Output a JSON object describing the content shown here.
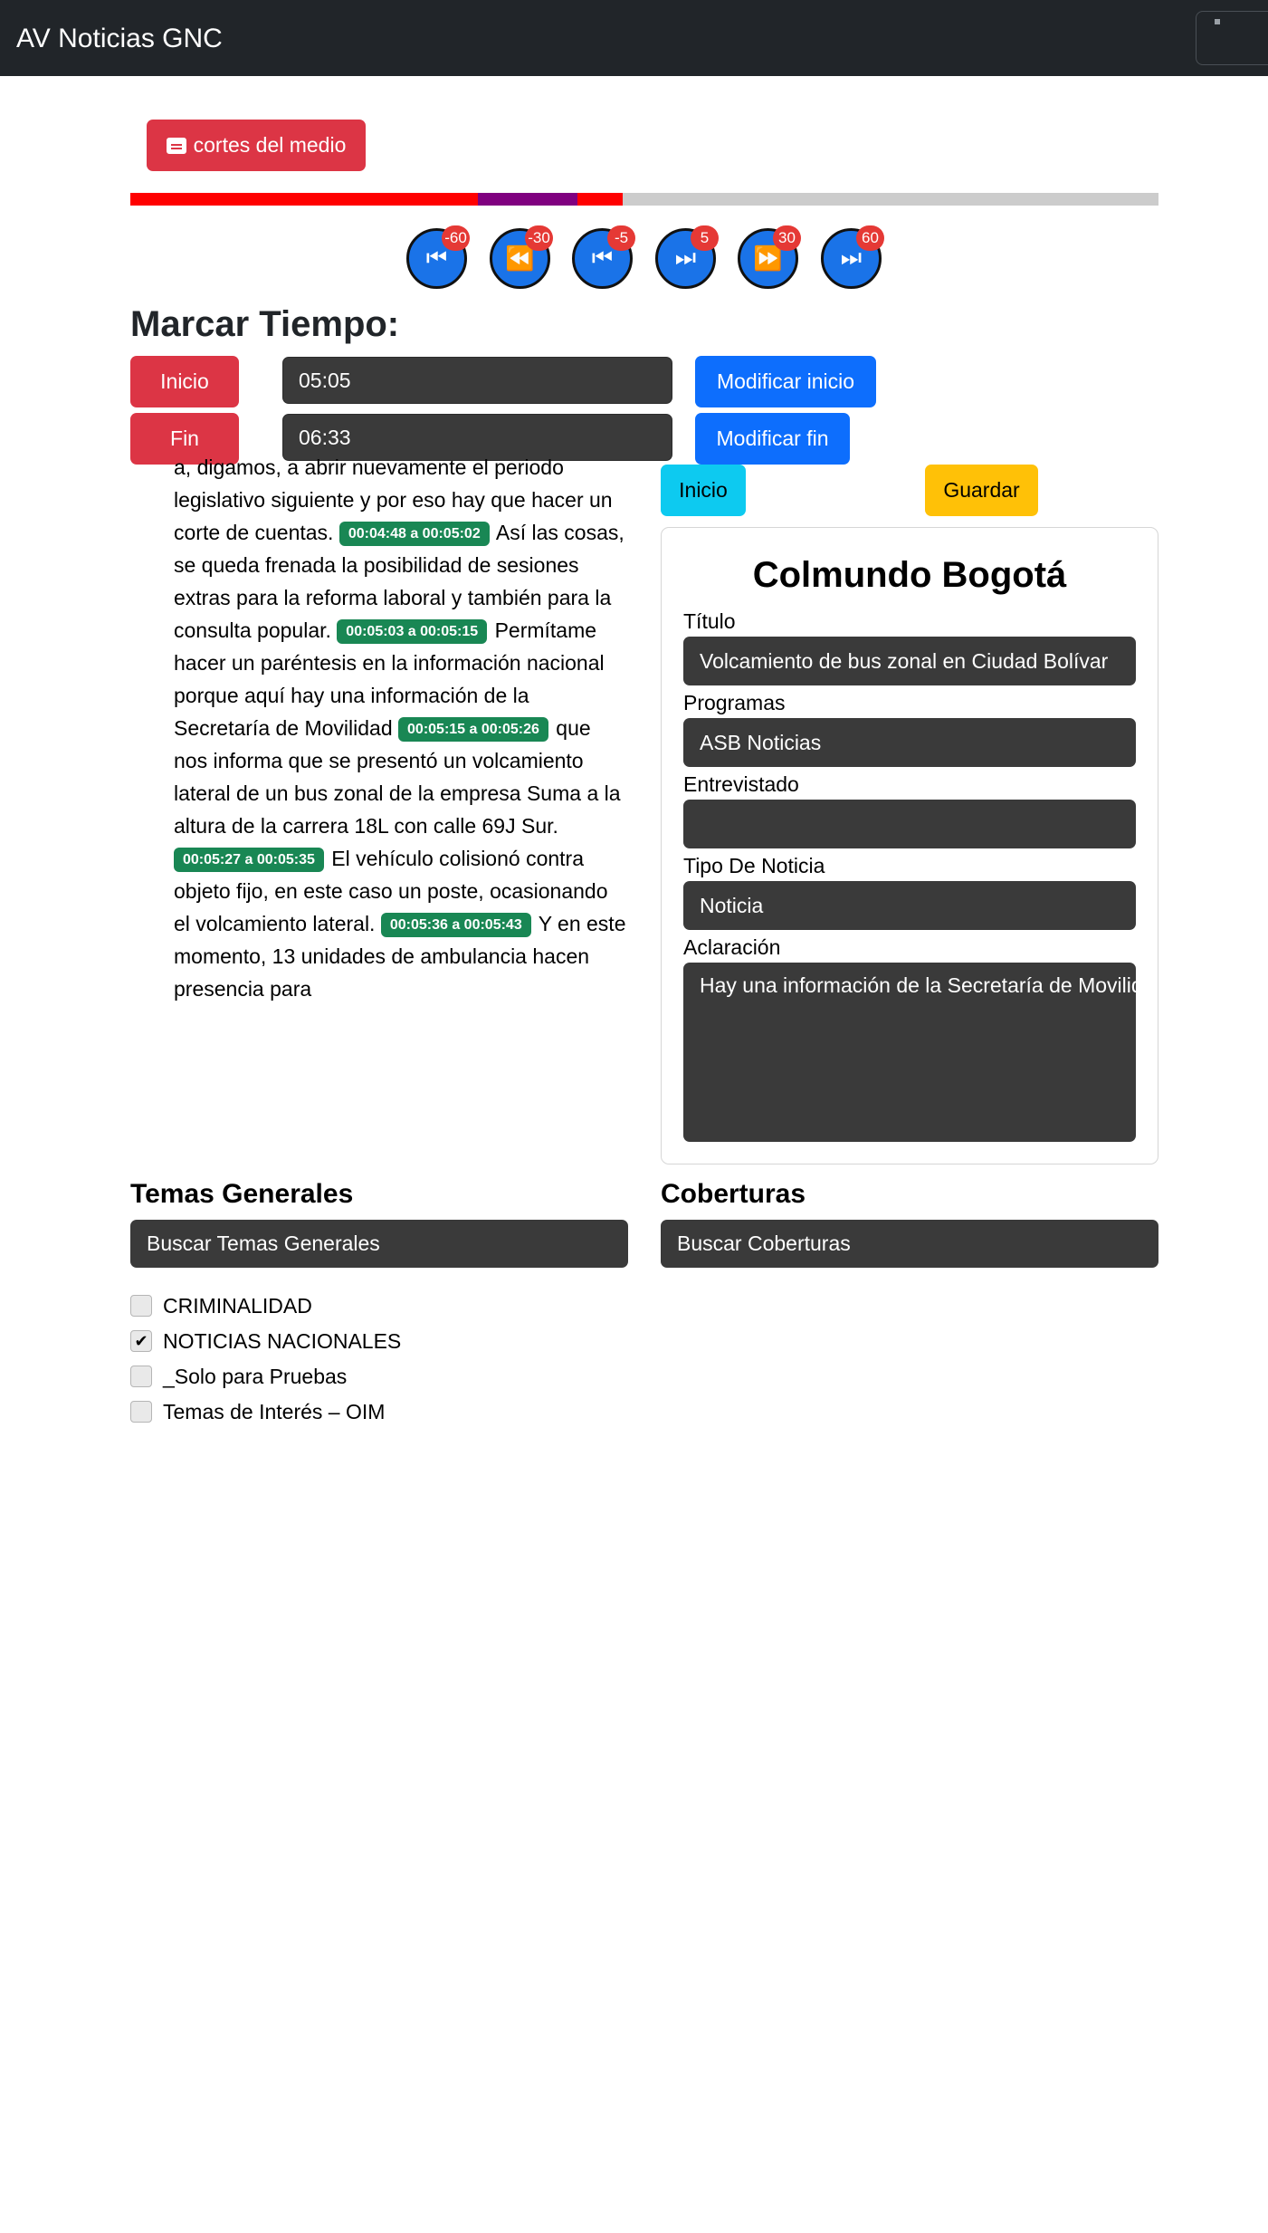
{
  "navbar": {
    "brand": "AV Noticias GNC"
  },
  "cortes_button": {
    "label": "cortes del medio",
    "icon": "closed-captions-icon"
  },
  "progress": {
    "segments": [
      {
        "color": "#ff0000",
        "start": 0.0,
        "end": 0.338
      },
      {
        "color": "#800080",
        "start": 0.338,
        "end": 0.435
      },
      {
        "color": "#ff0000",
        "start": 0.435,
        "end": 0.479
      }
    ],
    "track_color": "#cccccc"
  },
  "controls": [
    {
      "glyph": "⏮",
      "badge": "-60",
      "name": "rewind-60-button"
    },
    {
      "glyph": "⏪",
      "badge": "-30",
      "name": "rewind-30-button"
    },
    {
      "glyph": "⏮",
      "badge": "-5",
      "name": "rewind-5-button"
    },
    {
      "glyph": "⏭",
      "badge": "5",
      "name": "forward-5-button"
    },
    {
      "glyph": "⏩",
      "badge": "30",
      "name": "forward-30-button"
    },
    {
      "glyph": "⏭",
      "badge": "60",
      "name": "forward-60-button"
    }
  ],
  "marcar": {
    "title": "Marcar Tiempo:",
    "inicio_label": "Inicio",
    "inicio_value": "05:05",
    "modificar_inicio": "Modificar inicio",
    "fin_label": "Fin",
    "fin_value": "06:33",
    "modificar_fin": "Modificar fin"
  },
  "transcript": {
    "lead": "a, digamos, a abrir nuevamente el periodo legislativo siguiente y por eso hay que hacer un corte de cuentas.",
    "segments": [
      {
        "time": "00:04:48 a 00:05:02",
        "text": "Así las cosas, se queda frenada la posibilidad de sesiones extras para la reforma laboral y también para la consulta popular."
      },
      {
        "time": "00:05:03 a 00:05:15",
        "text": "Permítame hacer un paréntesis en la información nacional porque aquí hay una información de la Secretaría de Movilidad"
      },
      {
        "time": "00:05:15 a 00:05:26",
        "text": "que nos informa que se presentó un volcamiento lateral de un bus zonal de la empresa Suma a la altura de la carrera 18L con calle 69J Sur."
      },
      {
        "time": "00:05:27 a 00:05:35",
        "text": "El vehículo colisionó contra objeto fijo, en este caso un poste, ocasionando el volcamiento lateral."
      },
      {
        "time": "00:05:36 a 00:05:43",
        "text": "Y en este momento, 13 unidades de ambulancia hacen presencia para"
      }
    ]
  },
  "actions": {
    "inicio": "Inicio",
    "guardar": "Guardar"
  },
  "card": {
    "title": "Colmundo Bogotá",
    "titulo_label": "Título",
    "titulo_value": "Volcamiento de bus zonal en Ciudad Bolívar",
    "programas_label": "Programas",
    "programas_value": "ASB Noticias",
    "entrevistado_label": "Entrevistado",
    "entrevistado_value": "",
    "tipo_label": "Tipo De Noticia",
    "tipo_value": "Noticia",
    "aclaracion_label": "Aclaración",
    "aclaracion_value": "Hay una información de la Secretaría de Movilidad"
  },
  "temas": {
    "heading": "Temas Generales",
    "search_placeholder": "Buscar Temas Generales",
    "items": [
      {
        "label": "CRIMINALIDAD",
        "checked": false
      },
      {
        "label": "NOTICIAS NACIONALES",
        "checked": true
      },
      {
        "label": "_Solo para Pruebas",
        "checked": false
      },
      {
        "label": "Temas de Interés – OIM",
        "checked": false
      }
    ]
  },
  "coberturas": {
    "heading": "Coberturas",
    "search_placeholder": "Buscar Coberturas"
  }
}
